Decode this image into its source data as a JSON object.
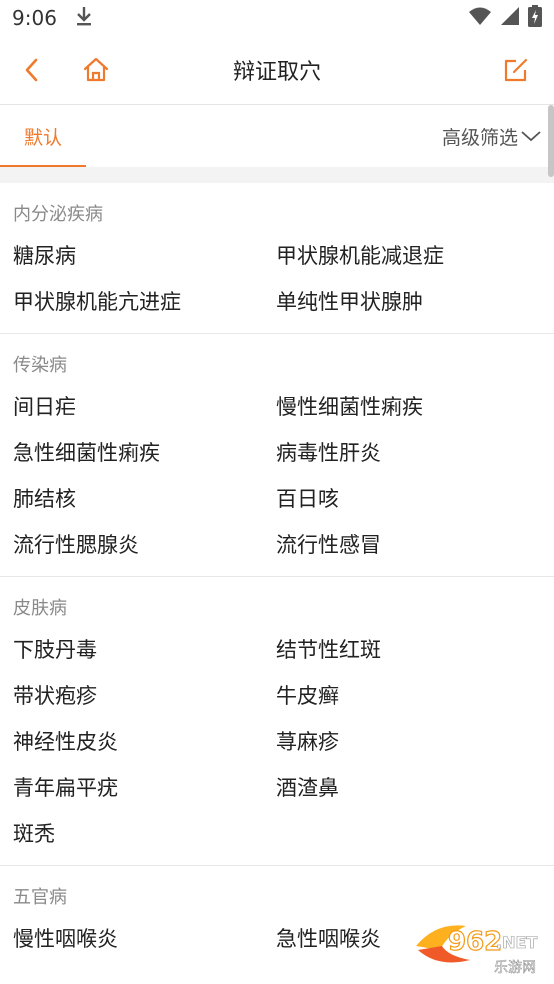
{
  "status_bar": {
    "time": "9:06"
  },
  "header": {
    "title": "辩证取穴"
  },
  "filter": {
    "default_tab": "默认",
    "advanced_label": "高级筛选"
  },
  "sections": [
    {
      "title": "内分泌疾病",
      "items": [
        "糖尿病",
        "甲状腺机能减退症",
        "甲状腺机能亢进症",
        "单纯性甲状腺肿"
      ]
    },
    {
      "title": "传染病",
      "items": [
        "间日疟",
        "慢性细菌性痢疾",
        "急性细菌性痢疾",
        "病毒性肝炎",
        "肺结核",
        "百日咳",
        "流行性腮腺炎",
        "流行性感冒"
      ]
    },
    {
      "title": "皮肤病",
      "items": [
        "下肢丹毒",
        "结节性红斑",
        "带状疱疹",
        "牛皮癣",
        "神经性皮炎",
        "荨麻疹",
        "青年扁平疣",
        "酒渣鼻",
        "斑秃"
      ]
    },
    {
      "title": "五官病",
      "items": [
        "慢性咽喉炎",
        "急性咽喉炎"
      ]
    }
  ],
  "watermark": {
    "brand": "962.NET",
    "sub": "乐游网"
  },
  "colors": {
    "accent": "#ef7a2e"
  }
}
